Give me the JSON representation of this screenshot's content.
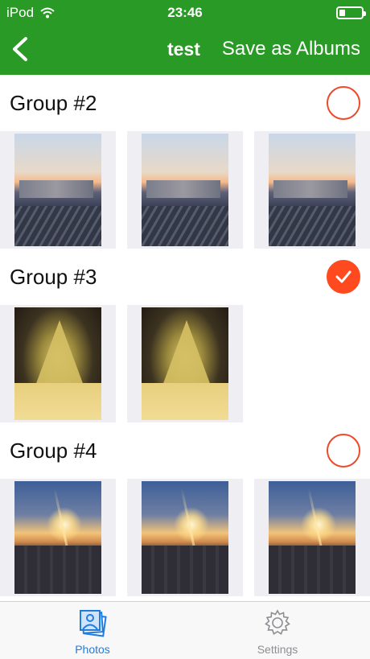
{
  "status_bar": {
    "carrier": "iPod",
    "time": "23:46",
    "battery_level": 0.25
  },
  "navbar": {
    "title": "test",
    "save_label": "Save as Albums",
    "back_icon": "chevron-left-icon"
  },
  "groups": [
    {
      "title": "Group #2",
      "selected": false,
      "photo_type": "sunset",
      "photo_count": 3
    },
    {
      "title": "Group #3",
      "selected": true,
      "photo_type": "snowy-tree",
      "photo_count": 2
    },
    {
      "title": "Group #4",
      "selected": false,
      "photo_type": "sunrise",
      "photo_count": 3
    }
  ],
  "tabs": [
    {
      "label": "Photos",
      "icon": "photos-icon",
      "active": true
    },
    {
      "label": "Settings",
      "icon": "gear-icon",
      "active": false
    }
  ],
  "colors": {
    "header": "#2a9a26",
    "check_active": "#ff4a1f",
    "tab_active": "#1f7de0",
    "tab_inactive": "#8e8e93"
  }
}
